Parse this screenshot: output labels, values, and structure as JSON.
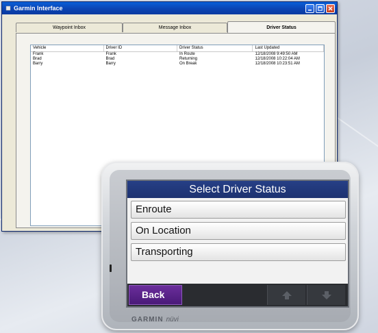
{
  "window": {
    "title": "Garmin Interface",
    "tabs": [
      {
        "label": "Waypoint Inbox"
      },
      {
        "label": "Message Inbox"
      },
      {
        "label": "Driver Status"
      }
    ],
    "active_tab": "Driver Status",
    "columns": [
      "Vehicle",
      "Driver ID",
      "Driver Status",
      "Last Updated"
    ],
    "rows": [
      [
        "Frank",
        "Frank",
        "In Route",
        "12/18/2008 9:49:50 AM"
      ],
      [
        "Brad",
        "Brad",
        "Returning",
        "12/18/2008 10:22:04 AM"
      ],
      [
        "Barry",
        "Barry",
        "On Break",
        "12/18/2008 10:23:51 AM"
      ]
    ]
  },
  "device": {
    "screen_title": "Select Driver Status",
    "options": [
      "Enroute",
      "On Location",
      "Transporting"
    ],
    "back_label": "Back",
    "brand": "GARMIN",
    "model": "nüvi"
  },
  "colors": {
    "titlebar": "#0b44b3",
    "screen_header": "#1d3270",
    "back_button": "#5a2387"
  },
  "icons": [
    "app-icon",
    "minimize-icon",
    "maximize-icon",
    "close-icon",
    "arrow-up-icon",
    "arrow-down-icon"
  ]
}
